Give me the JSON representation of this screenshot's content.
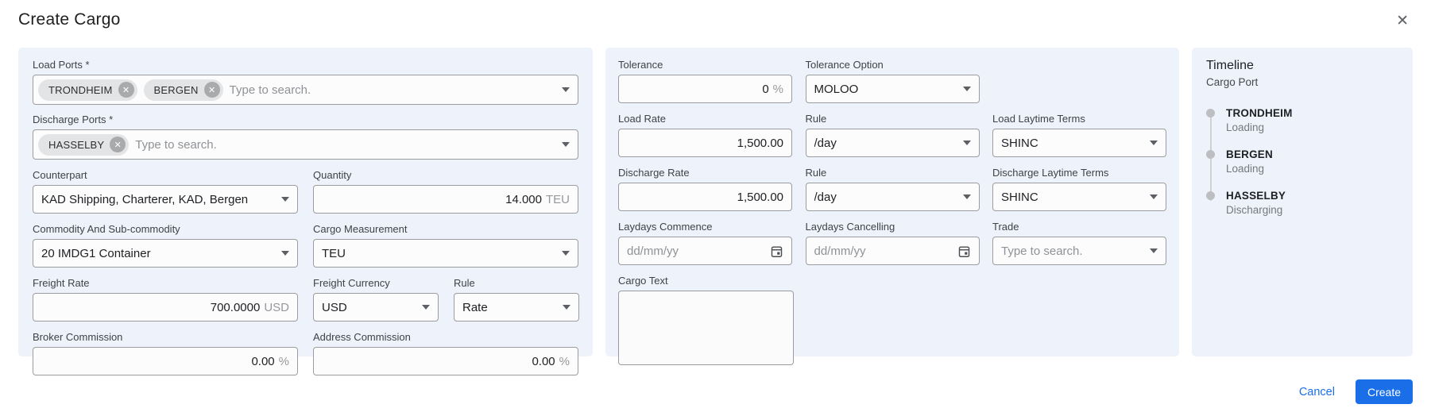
{
  "header": {
    "title": "Create Cargo"
  },
  "icons": {
    "close": "✕",
    "chip_remove": "✕",
    "caret_down": "caret-down-icon",
    "calendar": "calendar-icon"
  },
  "left_panel": {
    "load_ports": {
      "label": "Load Ports *",
      "chips": [
        "TRONDHEIM",
        "BERGEN"
      ],
      "placeholder": "Type to search."
    },
    "discharge_ports": {
      "label": "Discharge Ports *",
      "chips": [
        "HASSELBY"
      ],
      "placeholder": "Type to search."
    },
    "counterpart": {
      "label": "Counterpart",
      "value": "KAD Shipping, Charterer, KAD, Bergen"
    },
    "quantity": {
      "label": "Quantity",
      "value": "14.000",
      "unit": "TEU"
    },
    "commodity": {
      "label": "Commodity And Sub-commodity",
      "value": "20 IMDG1 Container"
    },
    "cargo_measurement": {
      "label": "Cargo Measurement",
      "value": "TEU"
    },
    "freight_rate": {
      "label": "Freight Rate",
      "value": "700.0000",
      "unit": "USD"
    },
    "freight_currency": {
      "label": "Freight Currency",
      "value": "USD"
    },
    "freight_rule": {
      "label": "Rule",
      "value": "Rate"
    },
    "broker_commission": {
      "label": "Broker Commission",
      "value": "0.00",
      "unit": "%"
    },
    "address_commission": {
      "label": "Address Commission",
      "value": "0.00",
      "unit": "%"
    }
  },
  "middle_panel": {
    "tolerance": {
      "label": "Tolerance",
      "value": "0",
      "unit": "%"
    },
    "tolerance_option": {
      "label": "Tolerance Option",
      "value": "MOLOO"
    },
    "load_rate": {
      "label": "Load Rate",
      "value": "1,500.00"
    },
    "load_rule": {
      "label": "Rule",
      "value": "/day"
    },
    "load_laytime_terms": {
      "label": "Load Laytime Terms",
      "value": "SHINC"
    },
    "discharge_rate": {
      "label": "Discharge Rate",
      "value": "1,500.00"
    },
    "discharge_rule": {
      "label": "Rule",
      "value": "/day"
    },
    "discharge_laytime_terms": {
      "label": "Discharge Laytime Terms",
      "value": "SHINC"
    },
    "laydays_commence": {
      "label": "Laydays Commence",
      "placeholder": "dd/mm/yy"
    },
    "laydays_cancelling": {
      "label": "Laydays Cancelling",
      "placeholder": "dd/mm/yy"
    },
    "trade": {
      "label": "Trade",
      "placeholder": "Type to search."
    },
    "cargo_text": {
      "label": "Cargo Text",
      "value": ""
    }
  },
  "timeline_panel": {
    "title": "Timeline",
    "subtitle": "Cargo Port",
    "items": [
      {
        "port": "TRONDHEIM",
        "activity": "Loading"
      },
      {
        "port": "BERGEN",
        "activity": "Loading"
      },
      {
        "port": "HASSELBY",
        "activity": "Discharging"
      }
    ]
  },
  "footer": {
    "cancel_label": "Cancel",
    "create_label": "Create"
  },
  "colors": {
    "accent_blue": "#1a6ee8",
    "panel_bg": "#edf2fb",
    "chip_bg": "#e3e4e6",
    "timeline_dot": "#bcbec1"
  }
}
